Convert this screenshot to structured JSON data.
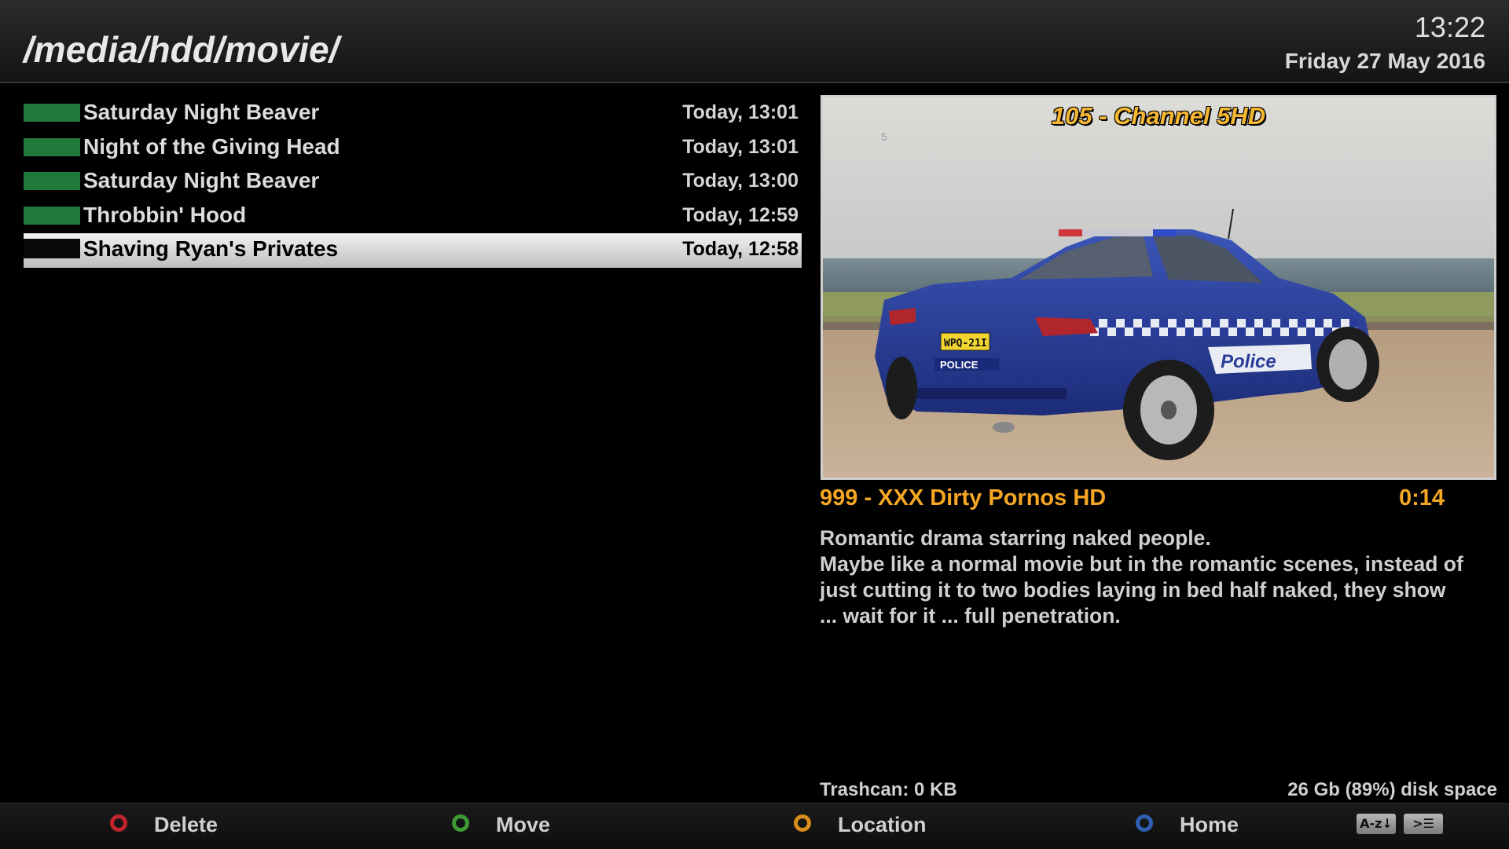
{
  "header": {
    "path": "/media/hdd/movie/",
    "clock": "13:22",
    "date": "Friday 27 May 2016"
  },
  "recordings": [
    {
      "title": "Saturday Night Beaver",
      "time": "Today, 13:01",
      "selected": false
    },
    {
      "title": "Night of the Giving Head",
      "time": "Today, 13:01",
      "selected": false
    },
    {
      "title": "Saturday Night Beaver",
      "time": "Today, 13:00",
      "selected": false
    },
    {
      "title": "Throbbin' Hood",
      "time": "Today, 12:59",
      "selected": false
    },
    {
      "title": "Shaving Ryan's Privates",
      "time": "Today, 12:58",
      "selected": true
    }
  ],
  "preview": {
    "channel_overlay": "105 - Channel 5HD",
    "image_description": "Blue police car parked by the sea",
    "badge_text": "POLICE",
    "door_text": "Police",
    "plate_text": "WPQ-21I"
  },
  "info": {
    "channel": "999 - XXX Dirty Pornos HD",
    "duration": "0:14",
    "description_lines": [
      "Romantic drama starring naked people.",
      "Maybe like a normal movie but in the romantic scenes, instead of",
      "just cutting it to two bodies laying in bed half naked, they show",
      "... wait for it ... full penetration."
    ]
  },
  "status": {
    "trashcan": "Trashcan: 0 KB",
    "disk": "26 Gb (89%) disk space"
  },
  "footer": {
    "delete": "Delete",
    "move": "Move",
    "location": "Location",
    "home": "Home",
    "sort_key": "A-z↓",
    "menu_key": ">☰"
  },
  "colors": {
    "recording_bar": "#1f7a3a",
    "accent": "#f5a623",
    "red": "#c0232b",
    "green": "#3e9a35",
    "yellow": "#d78c1c",
    "blue": "#2f5fb3"
  }
}
